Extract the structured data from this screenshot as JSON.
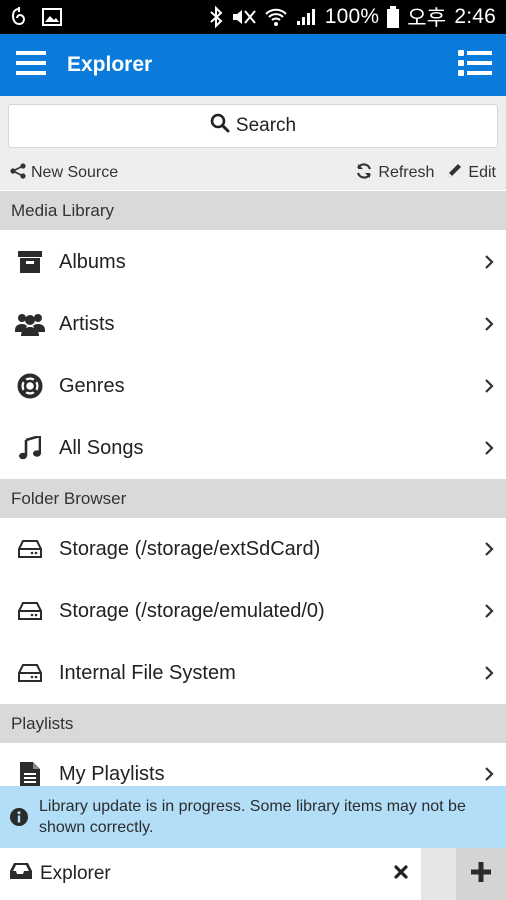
{
  "status_bar": {
    "battery_text": "100%",
    "ampm": "오후",
    "time": "2:46",
    "icons": [
      "notification-icon",
      "image-icon",
      "bluetooth-icon",
      "mute-icon",
      "wifi-icon",
      "signal-icon",
      "battery-icon"
    ]
  },
  "app_bar": {
    "title": "Explorer",
    "color": "#0a7bdb"
  },
  "search": {
    "label": "Search"
  },
  "actions": {
    "new_source": "New Source",
    "refresh": "Refresh",
    "edit": "Edit"
  },
  "sections": [
    {
      "title": "Media Library",
      "items": [
        {
          "label": "Albums",
          "icon": "archive-icon"
        },
        {
          "label": "Artists",
          "icon": "users-icon"
        },
        {
          "label": "Genres",
          "icon": "lifebuoy-icon"
        },
        {
          "label": "All Songs",
          "icon": "music-note-icon"
        }
      ]
    },
    {
      "title": "Folder Browser",
      "items": [
        {
          "label": "Storage (/storage/extSdCard)",
          "icon": "drive-icon"
        },
        {
          "label": "Storage (/storage/emulated/0)",
          "icon": "drive-icon"
        },
        {
          "label": "Internal File System",
          "icon": "drive-icon"
        }
      ]
    },
    {
      "title": "Playlists",
      "items": [
        {
          "label": "My Playlists",
          "icon": "document-icon"
        }
      ]
    }
  ],
  "notice": {
    "text": "Library update is in progress. Some library items may not be shown correctly.",
    "color": "#b3def8"
  },
  "bottom_bar": {
    "tab_label": "Explorer"
  }
}
